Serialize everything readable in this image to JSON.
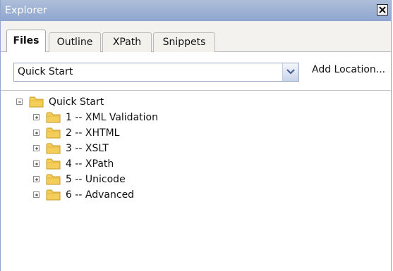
{
  "window": {
    "title": "Explorer",
    "close_glyph": "close-icon"
  },
  "tabs": [
    {
      "label": "Files",
      "active": true
    },
    {
      "label": "Outline",
      "active": false
    },
    {
      "label": "XPath",
      "active": false
    },
    {
      "label": "Snippets",
      "active": false
    }
  ],
  "toolbar": {
    "location_value": "Quick Start",
    "dropdown_icon": "chevron-down-icon",
    "add_location_label": "Add Location..."
  },
  "tree": {
    "root": {
      "label": "Quick Start",
      "expanded": true,
      "icon": "folder-icon"
    },
    "children": [
      {
        "label": "1 -- XML Validation",
        "expanded": false
      },
      {
        "label": "2 -- XHTML",
        "expanded": false
      },
      {
        "label": "3 -- XSLT",
        "expanded": false
      },
      {
        "label": "4 -- XPath",
        "expanded": false
      },
      {
        "label": "5 -- Unicode",
        "expanded": false
      },
      {
        "label": "6 -- Advanced",
        "expanded": false
      }
    ]
  },
  "colors": {
    "titlebar": "#9fb2d6",
    "folder_fill": "#f3cf5a",
    "folder_stroke": "#c79a1f"
  }
}
